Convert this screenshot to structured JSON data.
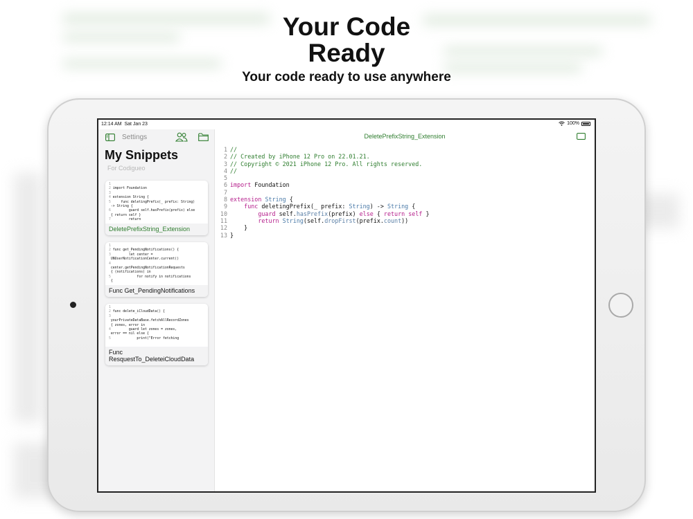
{
  "marketing": {
    "headline_line1": "Your Code",
    "headline_line2": "Ready",
    "subheadline": "Your code ready to use anywhere"
  },
  "status_bar": {
    "time": "12:14 AM",
    "date": "Sat Jan 23",
    "battery": "100%"
  },
  "sidebar": {
    "settings_label": "Settings",
    "title": "My Snippets",
    "subtitle": "For Codigueo",
    "toggle_icon": "sidebar-toggle-icon",
    "people_icon": "people-icon",
    "folder_icon": "folder-icon",
    "snippets": [
      {
        "label": "DeletePrefixString_Extension",
        "active": true,
        "preview": [
          {
            "n": "1",
            "t": ""
          },
          {
            "n": "2",
            "t": "import Foundation"
          },
          {
            "n": "3",
            "t": ""
          },
          {
            "n": "4",
            "t": "extension String {"
          },
          {
            "n": "5",
            "t": "    func deletingPrefix(_ prefix: String)"
          },
          {
            "n": "",
            "t": "-> String {"
          },
          {
            "n": "6",
            "t": "        guard self.hasPrefix(prefix) else"
          },
          {
            "n": "",
            "t": "{ return self }"
          },
          {
            "n": "7",
            "t": "        return"
          }
        ]
      },
      {
        "label": "Func Get_PendingNotifications",
        "active": false,
        "preview": [
          {
            "n": "1",
            "t": ""
          },
          {
            "n": "2",
            "t": "func get_PendingNotifications() {"
          },
          {
            "n": "3",
            "t": "        let center ="
          },
          {
            "n": "",
            "t": "UNUserNotificationCenter.current()"
          },
          {
            "n": "4",
            "t": ""
          },
          {
            "n": "",
            "t": "center.getPendingNotificationRequests"
          },
          {
            "n": "",
            "t": "{ (notifications) in"
          },
          {
            "n": "5",
            "t": "            for notify in notifications"
          },
          {
            "n": "",
            "t": "{"
          }
        ]
      },
      {
        "label": "Func ResquestTo_DeleteiCloudData",
        "active": false,
        "preview": [
          {
            "n": "1",
            "t": ""
          },
          {
            "n": "2",
            "t": "func delete_iCloudData() {"
          },
          {
            "n": "3",
            "t": ""
          },
          {
            "n": "",
            "t": "yourPrivateDataBase.fetchAllRecordZones"
          },
          {
            "n": "",
            "t": "{ zones, error in"
          },
          {
            "n": "4",
            "t": "        guard let zones = zones,"
          },
          {
            "n": "",
            "t": "error == nil else {"
          },
          {
            "n": "5",
            "t": "            print(\"Error fetching"
          }
        ]
      }
    ]
  },
  "editor": {
    "title": "DeletePrefixString_Extension",
    "panel_icon": "panel-icon",
    "add_icon": "plus-icon",
    "add_label": "+",
    "lines": [
      {
        "n": "1",
        "parts": [
          {
            "t": "//",
            "c": "cm"
          }
        ]
      },
      {
        "n": "2",
        "parts": [
          {
            "t": "// Created by iPhone 12 Pro on 22.01.21.",
            "c": "cm"
          }
        ]
      },
      {
        "n": "3",
        "parts": [
          {
            "t": "// Copyright © 2021 iPhone 12 Pro. All rights reserved.",
            "c": "cm"
          }
        ]
      },
      {
        "n": "4",
        "parts": [
          {
            "t": "//",
            "c": "cm"
          }
        ]
      },
      {
        "n": "5",
        "parts": []
      },
      {
        "n": "6",
        "parts": [
          {
            "t": "import",
            "c": "kw"
          },
          {
            "t": " Foundation",
            "c": ""
          }
        ]
      },
      {
        "n": "7",
        "parts": []
      },
      {
        "n": "8",
        "parts": [
          {
            "t": "extension",
            "c": "kw"
          },
          {
            "t": " ",
            "c": ""
          },
          {
            "t": "String",
            "c": "ty"
          },
          {
            "t": " {",
            "c": ""
          }
        ]
      },
      {
        "n": "9",
        "parts": [
          {
            "t": "    ",
            "c": ""
          },
          {
            "t": "func",
            "c": "kw"
          },
          {
            "t": " deletingPrefix(_ prefix: ",
            "c": ""
          },
          {
            "t": "String",
            "c": "ty"
          },
          {
            "t": ") -> ",
            "c": ""
          },
          {
            "t": "String",
            "c": "ty"
          },
          {
            "t": " {",
            "c": ""
          }
        ]
      },
      {
        "n": "10",
        "parts": [
          {
            "t": "        ",
            "c": ""
          },
          {
            "t": "guard",
            "c": "kw"
          },
          {
            "t": " self.",
            "c": ""
          },
          {
            "t": "hasPrefix",
            "c": "fn"
          },
          {
            "t": "(prefix) ",
            "c": ""
          },
          {
            "t": "else",
            "c": "kw"
          },
          {
            "t": " { ",
            "c": ""
          },
          {
            "t": "return",
            "c": "kw"
          },
          {
            "t": " ",
            "c": ""
          },
          {
            "t": "self",
            "c": "kw"
          },
          {
            "t": " }",
            "c": ""
          }
        ]
      },
      {
        "n": "11",
        "parts": [
          {
            "t": "        ",
            "c": ""
          },
          {
            "t": "return",
            "c": "kw"
          },
          {
            "t": " ",
            "c": ""
          },
          {
            "t": "String",
            "c": "ty"
          },
          {
            "t": "(self.",
            "c": ""
          },
          {
            "t": "dropFirst",
            "c": "fn"
          },
          {
            "t": "(prefix.",
            "c": ""
          },
          {
            "t": "count",
            "c": "fn"
          },
          {
            "t": "))",
            "c": ""
          }
        ]
      },
      {
        "n": "12",
        "parts": [
          {
            "t": "    }",
            "c": ""
          }
        ]
      },
      {
        "n": "13",
        "parts": [
          {
            "t": "}",
            "c": ""
          }
        ]
      }
    ]
  },
  "colors": {
    "accent_green": "#2e7d2e",
    "keyword_pink": "#b41c8a",
    "type_blue": "#4a7aa8"
  }
}
